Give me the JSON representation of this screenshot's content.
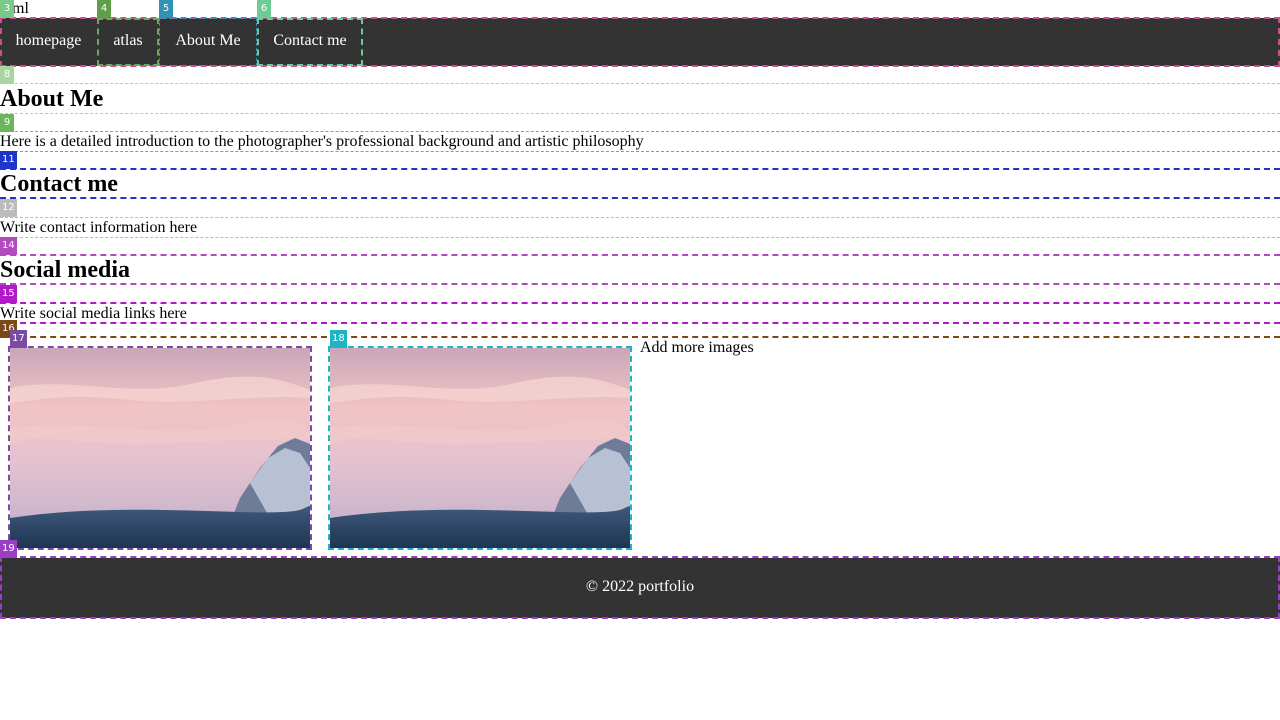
{
  "top": {
    "text": "ml"
  },
  "nav": {
    "items": [
      {
        "label": "homepage"
      },
      {
        "label": "atlas"
      },
      {
        "label": "About Me"
      },
      {
        "label": "Contact me"
      }
    ]
  },
  "about": {
    "title": "About Me",
    "text": "Here is a detailed introduction to the photographer's professional background and artistic philosophy"
  },
  "contact": {
    "title": "Contact me",
    "text": "Write contact information here"
  },
  "social": {
    "title": "Social media",
    "text": "Write social media links here"
  },
  "gallery": {
    "more_text": "Add more images",
    "images": [
      {
        "name": "mountain-sunset-photo"
      },
      {
        "name": "mountain-sunset-photo"
      }
    ]
  },
  "footer": {
    "text": "© 2022 portfolio"
  },
  "markers": [
    "3",
    "4",
    "5",
    "6",
    "8",
    "9",
    "11",
    "12",
    "14",
    "15",
    "16",
    "17",
    "18",
    "19"
  ],
  "colors": {
    "nav_bg": "#333333",
    "footer_bg": "#333333",
    "text": "#000000",
    "nav_text": "#ffffff"
  }
}
